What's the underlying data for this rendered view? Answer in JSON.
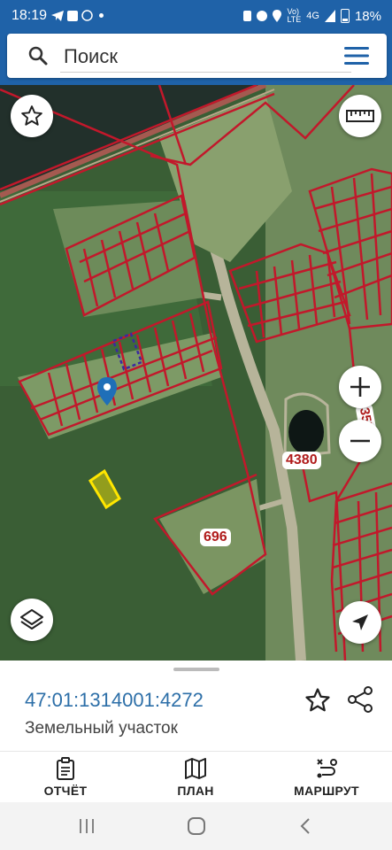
{
  "status_bar": {
    "time": "18:19",
    "signal_label_top": "Vo)",
    "signal_label_bottom": "LTE",
    "network": "4G",
    "battery": "18%"
  },
  "search": {
    "placeholder": "Поиск"
  },
  "map": {
    "labels": {
      "label_4380": "4380",
      "label_696": "696",
      "label_3579": "3579"
    }
  },
  "parcel": {
    "cadastral_number": "47:01:1314001:4272",
    "type": "Земельный участок"
  },
  "actions": {
    "report": "ОТЧЁТ",
    "plan": "ПЛАН",
    "route": "МАРШРУТ"
  },
  "colors": {
    "header": "#1f62a8",
    "parcel_border": "#c2182b",
    "accent": "#2d6fa8"
  }
}
